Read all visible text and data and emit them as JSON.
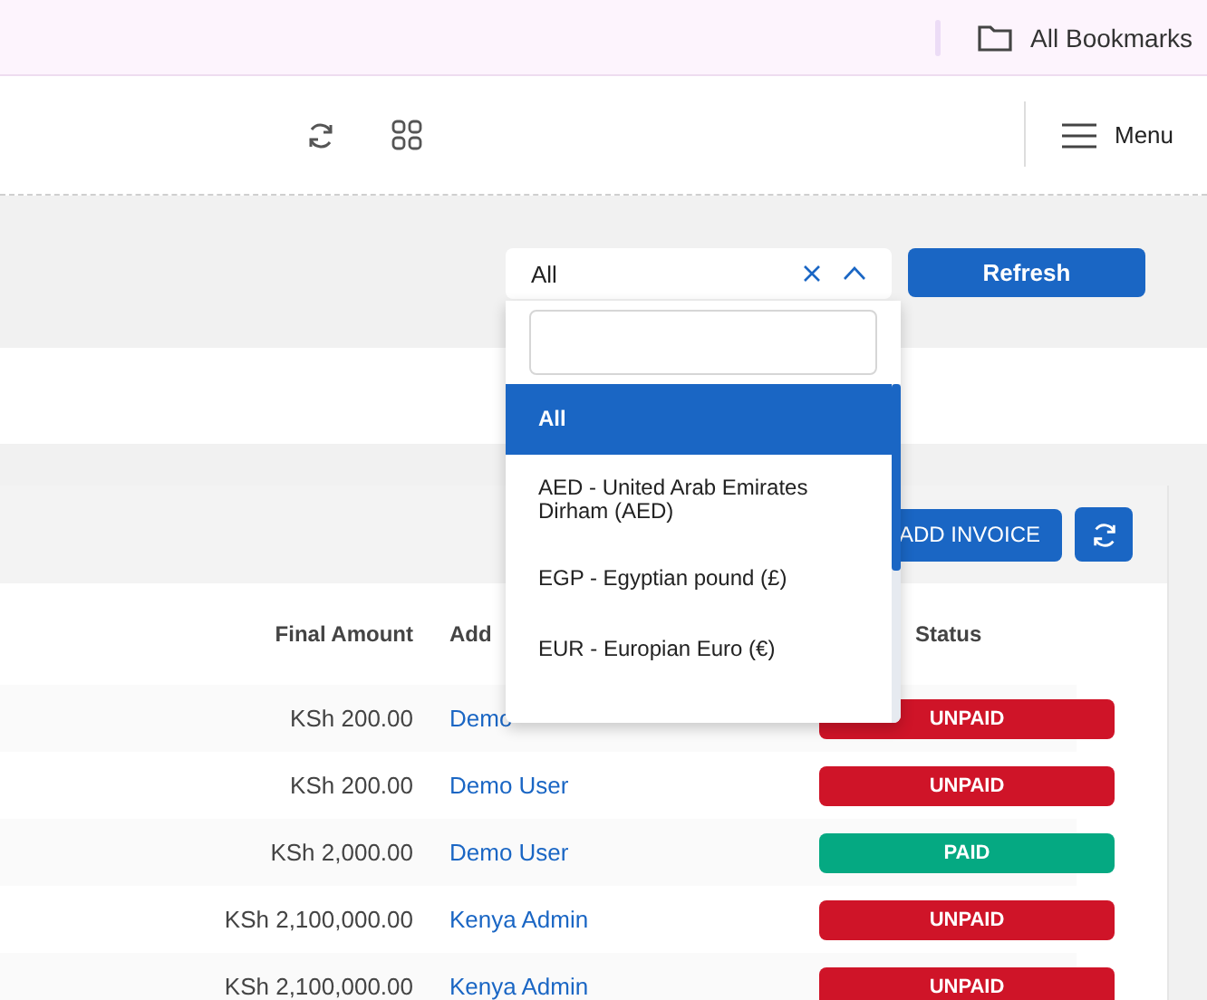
{
  "bookmarks_bar": {
    "label": "All Bookmarks"
  },
  "header": {
    "menu_label": "Menu"
  },
  "filter": {
    "value": "All",
    "open": true,
    "refresh_label": "Refresh",
    "options": [
      {
        "label": "All",
        "selected": true
      },
      {
        "label": "AED - United Arab Emirates Dirham (AED)",
        "selected": false
      },
      {
        "label": "EGP - Egyptian pound (£)",
        "selected": false
      },
      {
        "label": "EUR - Europian Euro (€)",
        "selected": false
      }
    ]
  },
  "card": {
    "add_button": "ADD INVOICE"
  },
  "table": {
    "columns": [
      "Final Amount",
      "Add",
      "Status"
    ],
    "rows": [
      {
        "amount": "KSh 200.00",
        "user": "Demo",
        "status": "UNPAID",
        "paid": false
      },
      {
        "amount": "KSh 200.00",
        "user": "Demo User",
        "status": "UNPAID",
        "paid": false
      },
      {
        "amount": "KSh 2,000.00",
        "user": "Demo User",
        "status": "PAID",
        "paid": true
      },
      {
        "amount": "KSh 2,100,000.00",
        "user": "Kenya Admin",
        "status": "UNPAID",
        "paid": false
      },
      {
        "amount": "KSh 2,100,000.00",
        "user": "Kenya Admin",
        "status": "UNPAID",
        "paid": false
      }
    ]
  }
}
